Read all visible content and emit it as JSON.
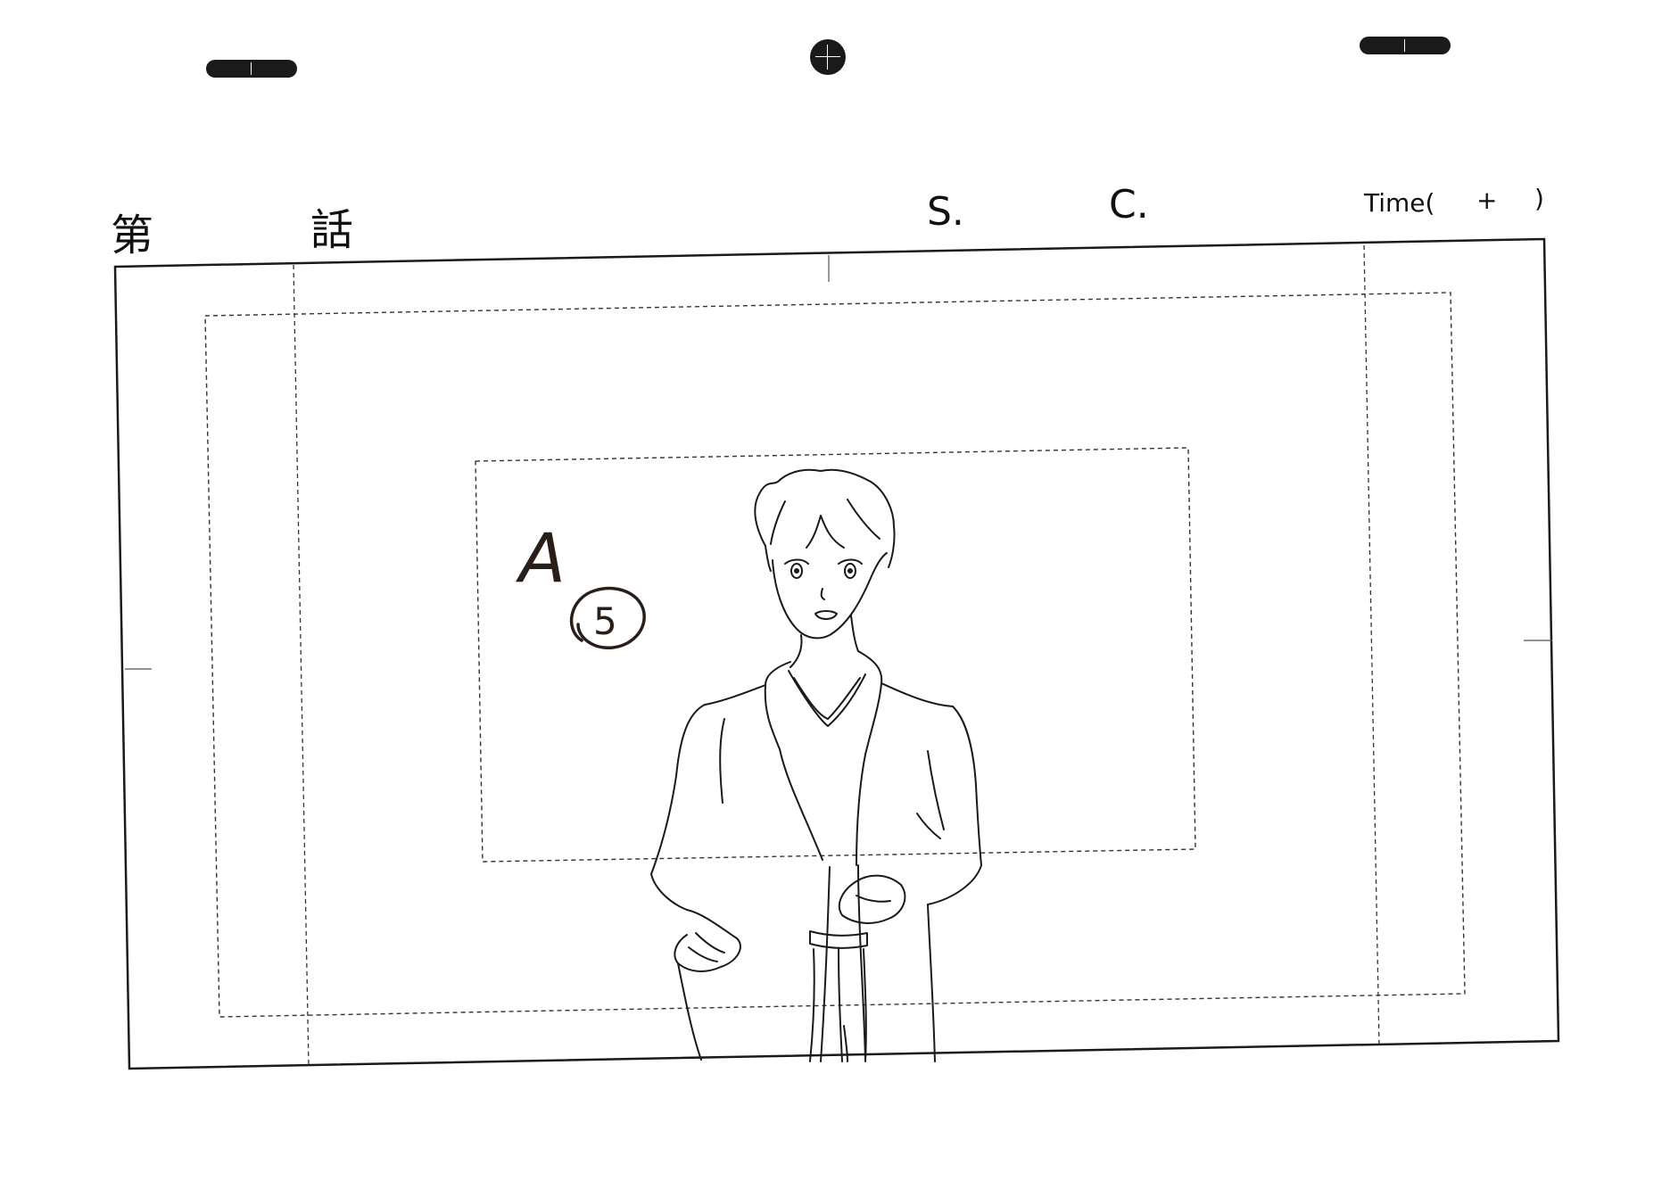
{
  "header": {
    "episode_prefix": "第",
    "episode_suffix": "話",
    "scene_label": "S.",
    "cut_label": "C.",
    "time_label": "Time(",
    "time_plus": "+",
    "time_close": ")"
  },
  "annotation": {
    "layer_letter": "A",
    "frame_number": "5"
  },
  "colors": {
    "paper": "#ffffff",
    "ink": "#111111",
    "guide": "#333333",
    "annotation_ink": "#2a1e18"
  },
  "icons": {
    "peg_left": "peg-slot-icon",
    "peg_center": "peg-round-icon",
    "peg_right": "peg-slot-icon"
  }
}
